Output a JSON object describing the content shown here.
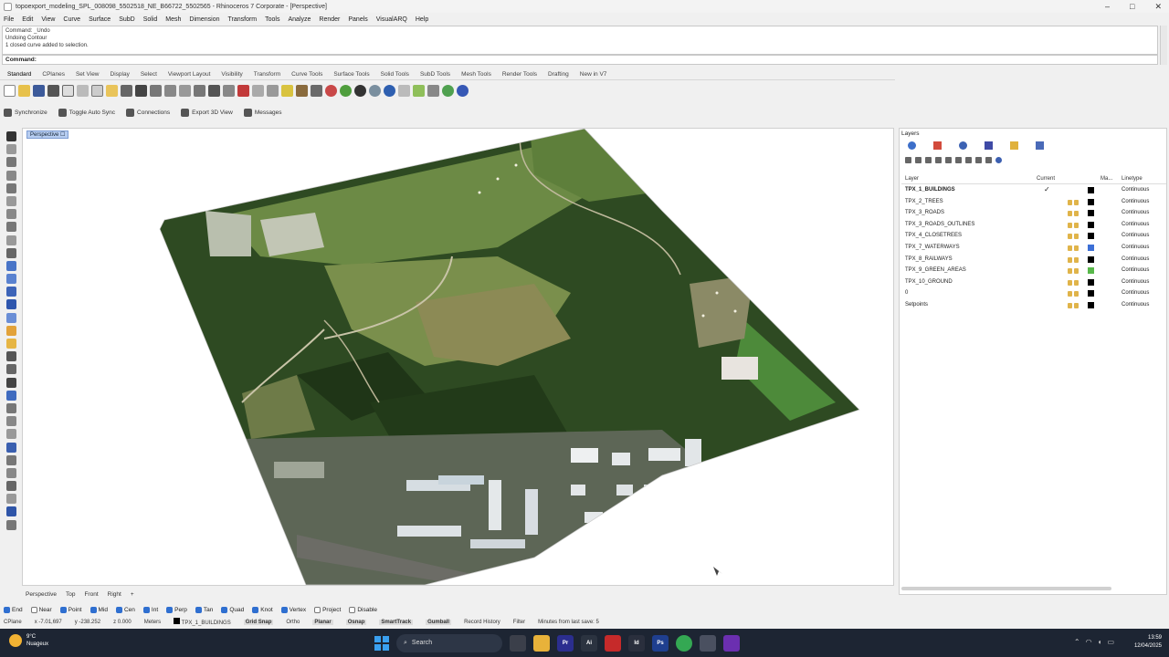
{
  "window": {
    "title": "topoexport_modeling_SPL_008098_5502518_NE_B66722_5502565 - Rhinoceros 7 Corporate - [Perspective]",
    "controls": [
      "–",
      "□",
      "✕"
    ]
  },
  "menu": [
    "File",
    "Edit",
    "View",
    "Curve",
    "Surface",
    "SubD",
    "Solid",
    "Mesh",
    "Dimension",
    "Transform",
    "Tools",
    "Analyze",
    "Render",
    "Panels",
    "VisualARQ",
    "Help"
  ],
  "command": {
    "history": [
      "Command: _Undo",
      "Undoing Contour",
      "1 closed curve added to selection."
    ],
    "prompt_label": "Command:",
    "prompt_value": ""
  },
  "toolbar_tabs": [
    "Standard",
    "CPlanes",
    "Set View",
    "Display",
    "Select",
    "Viewport Layout",
    "Visibility",
    "Transform",
    "Curve Tools",
    "Surface Tools",
    "Solid Tools",
    "SubD Tools",
    "Mesh Tools",
    "Render Tools",
    "Drafting",
    "New in V7"
  ],
  "toolbar2": [
    {
      "label": "Synchronize",
      "icon": "sync-icon"
    },
    {
      "label": "Toggle Auto Sync",
      "icon": "toggle-sync-icon"
    },
    {
      "label": "Connections",
      "icon": "connections-icon"
    },
    {
      "label": "Export 3D View",
      "icon": "export-icon"
    },
    {
      "label": "Messages",
      "icon": "messages-icon"
    }
  ],
  "viewport": {
    "label": "Perspective ☐"
  },
  "view_tabs": [
    "Perspective",
    "Top",
    "Front",
    "Right",
    "+"
  ],
  "osnaps": [
    {
      "label": "End",
      "on": true
    },
    {
      "label": "Near",
      "on": false
    },
    {
      "label": "Point",
      "on": true
    },
    {
      "label": "Mid",
      "on": true
    },
    {
      "label": "Cen",
      "on": true
    },
    {
      "label": "Int",
      "on": true
    },
    {
      "label": "Perp",
      "on": true
    },
    {
      "label": "Tan",
      "on": true
    },
    {
      "label": "Quad",
      "on": true
    },
    {
      "label": "Knot",
      "on": true
    },
    {
      "label": "Vertex",
      "on": true
    },
    {
      "label": "Project",
      "on": false
    },
    {
      "label": "Disable",
      "on": false
    }
  ],
  "status": {
    "cplane": "CPlane",
    "x": "x -7.01,697",
    "y": "y -238.252",
    "z": "z 0.000",
    "units": "Meters",
    "layer": "TPX_1_BUILDINGS",
    "toggles": [
      "Grid Snap",
      "Ortho",
      "Planar",
      "Osnap",
      "SmartTrack",
      "Gumball",
      "Record History",
      "Filter"
    ],
    "message": "Minutes from last save: 5"
  },
  "layers": {
    "title": "Layers",
    "columns": {
      "name": "Layer",
      "current": "Current",
      "material": "Ma...",
      "linetype": "Linetype"
    },
    "rows": [
      {
        "name": "TPX_1_BUILDINGS",
        "current": true,
        "color": "#000000",
        "linetype": "Continuous"
      },
      {
        "name": "TPX_2_TREES",
        "current": false,
        "color": "#000000",
        "linetype": "Continuous"
      },
      {
        "name": "TPX_3_ROADS",
        "current": false,
        "color": "#000000",
        "linetype": "Continuous"
      },
      {
        "name": "TPX_3_ROADS_OUTLINES",
        "current": false,
        "color": "#000000",
        "linetype": "Continuous"
      },
      {
        "name": "TPX_4_CLOSETREES",
        "current": false,
        "color": "#000000",
        "linetype": "Continuous"
      },
      {
        "name": "TPX_7_WATERWAYS",
        "current": false,
        "color": "#3c6fd6",
        "linetype": "Continuous"
      },
      {
        "name": "TPX_8_RAILWAYS",
        "current": false,
        "color": "#000000",
        "linetype": "Continuous"
      },
      {
        "name": "TPX_9_GREEN_AREAS",
        "current": false,
        "color": "#58b84a",
        "linetype": "Continuous"
      },
      {
        "name": "TPX_10_GROUND",
        "current": false,
        "color": "#000000",
        "linetype": "Continuous"
      },
      {
        "name": "0",
        "current": false,
        "color": "#000000",
        "linetype": "Continuous"
      },
      {
        "name": "Setpoints",
        "current": false,
        "color": "#000000",
        "linetype": "Continuous"
      }
    ]
  },
  "taskbar": {
    "weather_temp": "9°C",
    "weather_text": "Nuageux",
    "search_label": "Search",
    "time": "13:59",
    "date": "12/04/2025"
  }
}
